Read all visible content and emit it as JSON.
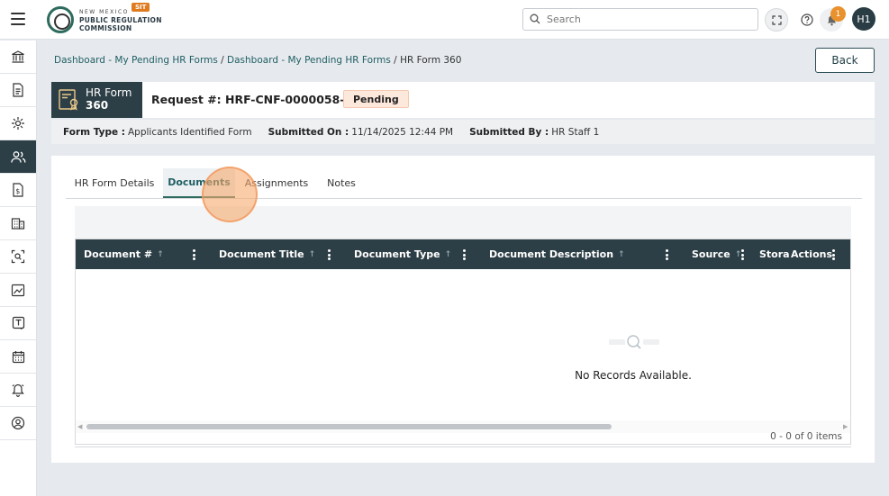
{
  "header": {
    "logo_line1": "NEW MEXICO",
    "logo_line2": "PUBLIC REGULATION",
    "logo_line3": "COMMISSION",
    "env_badge": "SIT",
    "search_placeholder": "Search",
    "notification_count": "1",
    "user_initials": "H1"
  },
  "sidebar": {
    "items": [
      {
        "icon": "bank-icon"
      },
      {
        "icon": "document-icon"
      },
      {
        "icon": "sun-burst-icon"
      },
      {
        "icon": "users-icon",
        "active": true
      },
      {
        "icon": "money-document-icon"
      },
      {
        "icon": "building-icon"
      },
      {
        "icon": "scan-search-icon"
      },
      {
        "icon": "chart-image-icon"
      },
      {
        "icon": "text-box-icon"
      },
      {
        "icon": "calendar-icon"
      },
      {
        "icon": "alarm-bell-icon"
      },
      {
        "icon": "user-circle-icon"
      }
    ]
  },
  "breadcrumb": {
    "items": [
      "Dashboard - My Pending HR Forms",
      "Dashboard - My Pending HR Forms"
    ],
    "separator": " / ",
    "current": "HR Form 360"
  },
  "back_label": "Back",
  "request": {
    "form_label_1": "HR Form",
    "form_label_2": "360",
    "request_text": "Request #: HRF-CNF-0000058-25",
    "status": "Pending"
  },
  "info": {
    "form_type_label": "Form Type :",
    "form_type_value": "Applicants Identified Form",
    "submitted_on_label": "Submitted On :",
    "submitted_on_value": "11/14/2025 12:44 PM",
    "submitted_by_label": "Submitted By :",
    "submitted_by_value": "HR Staff 1"
  },
  "tabs": [
    "HR Form Details",
    "Documents",
    "Assignments",
    "Notes"
  ],
  "active_tab": "Documents",
  "grid": {
    "columns": [
      "Document #",
      "Document Title",
      "Document Type",
      "Document Description",
      "Source",
      "Stora",
      "Actions"
    ],
    "empty_text": "No Records Available.",
    "pager": "0 - 0 of 0 items"
  },
  "colors": {
    "primary_dark": "#2d3f46",
    "accent_teal": "#2d6b5e",
    "pending_bg": "#fde8dc",
    "notification": "#e9912c"
  }
}
